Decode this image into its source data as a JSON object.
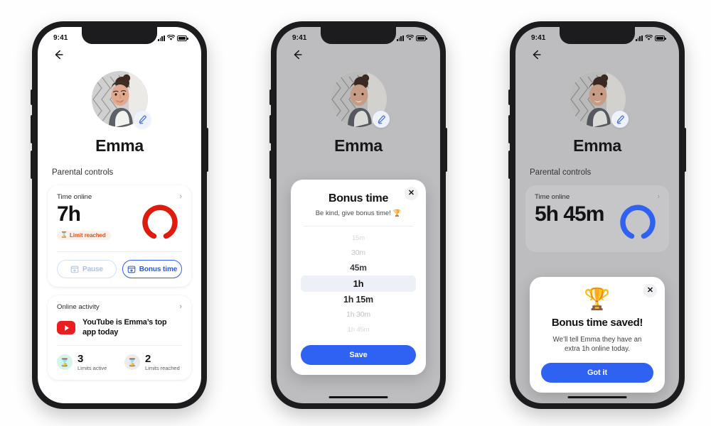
{
  "status_bar": {
    "time": "9:41",
    "signal_icon": "cellular-signal-icon",
    "wifi_icon": "wifi-icon",
    "battery_icon": "battery-icon"
  },
  "colors": {
    "brand_blue": "#2f62f2",
    "ghost_blue": "#a8bdf5",
    "limit_red": "#e2521b",
    "gauge_red": "#e01b0e",
    "gauge_blue": "#2f62f2",
    "overlay_gray": "#bdbdc0",
    "teal": "#d3f5ec"
  },
  "screen1": {
    "back_label": "Back",
    "profile_name": "Emma",
    "edit_icon": "pencil-edit-icon",
    "section_title": "Parental controls",
    "time_card": {
      "header": "Time online",
      "chevron": "›",
      "value": "7h",
      "badge_icon": "⌛",
      "badge_text": "Limit reached",
      "gauge_percent": 100,
      "gauge_color": "#e01b0e",
      "buttons": [
        {
          "label": "Pause",
          "icon": "pause-schedule-icon",
          "state": "disabled"
        },
        {
          "label": "Bonus time",
          "icon": "bonus-time-icon",
          "state": "active"
        }
      ]
    },
    "activity_card": {
      "header": "Online activity",
      "chevron": "›",
      "app_icon": "youtube-icon",
      "app_text": "YouTube is Emma’s top app today",
      "stats": [
        {
          "icon": "⌛",
          "tone": "teal",
          "count": "3",
          "label": "Limits active"
        },
        {
          "icon": "⌛",
          "tone": "gray",
          "count": "2",
          "label": "Limits reached"
        }
      ]
    }
  },
  "screen2": {
    "profile_name": "Emma",
    "modal": {
      "close_icon": "close-icon",
      "title": "Bonus time",
      "subtitle": "Be kind, give bonus time! 🏆",
      "options": [
        {
          "label": "15m",
          "tier": "f0"
        },
        {
          "label": "30m",
          "tier": "f1"
        },
        {
          "label": "45m",
          "tier": "f2"
        },
        {
          "label": "1h",
          "tier": "sel"
        },
        {
          "label": "1h 15m",
          "tier": "f2b"
        },
        {
          "label": "1h 30m",
          "tier": "f1"
        },
        {
          "label": "1h 45m",
          "tier": "f0"
        }
      ],
      "selected": "1h",
      "save_label": "Save"
    }
  },
  "screen3": {
    "profile_name": "Emma",
    "section_title": "Parental controls",
    "time_card": {
      "header": "Time online",
      "chevron": "›",
      "value": "5h 45m",
      "gauge_color": "#2f62f2"
    },
    "modal": {
      "close_icon": "close-icon",
      "trophy_icon": "🏆",
      "title": "Bonus time saved!",
      "body": "We’ll tell Emma they have an extra 1h online today.",
      "cta_label": "Got it"
    }
  }
}
